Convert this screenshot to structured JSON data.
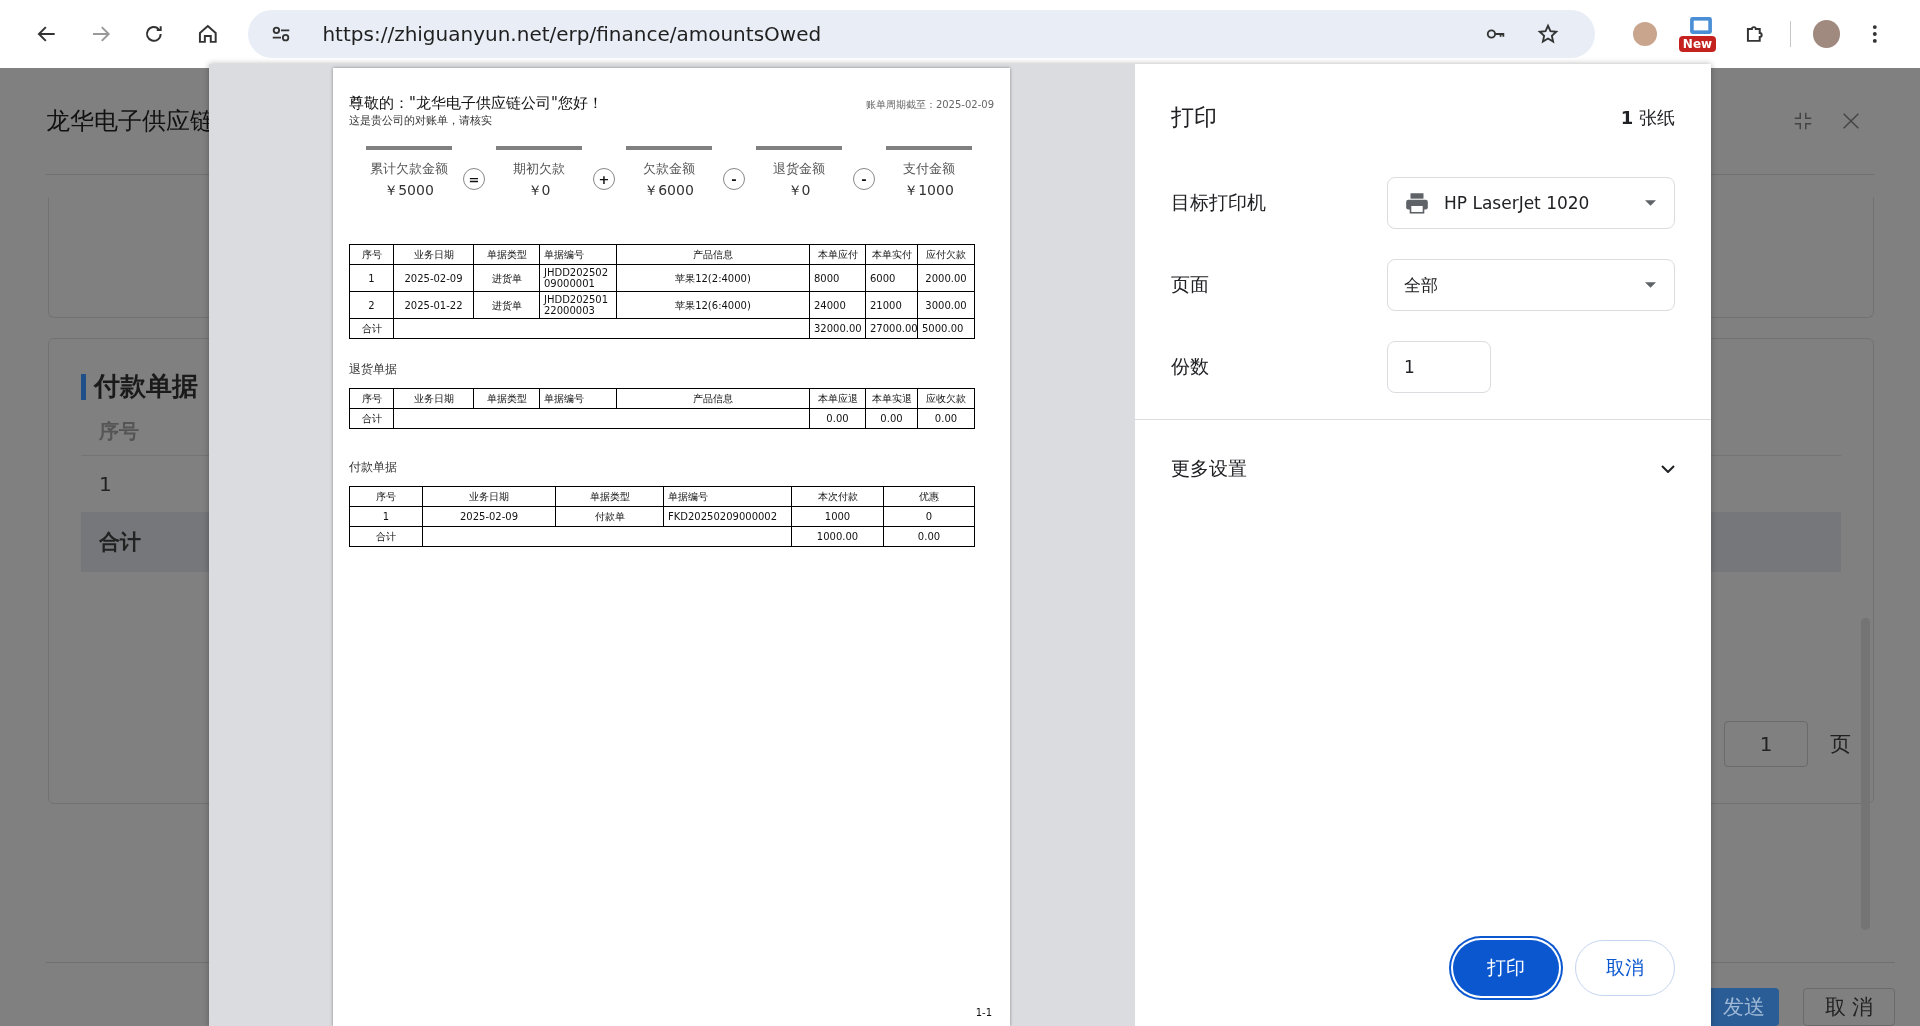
{
  "browser": {
    "url": "https://zhiguanyun.net/erp/finance/amountsOwed",
    "extension_badge": "New"
  },
  "background_page": {
    "title": "龙华电子供应链",
    "section_title": "付款单据",
    "column_header": "序号",
    "row_index": "1",
    "total_label": "合计",
    "page_input": "1",
    "page_unit": "页",
    "send_button": "发送",
    "cancel_button": "取 消"
  },
  "print_preview": {
    "greeting": "尊敬的：\"龙华电子供应链公司\"您好！",
    "subtitle": "这是贵公司的对账单，请核实",
    "period": "账单周期截至：2025-02-09",
    "summary": [
      {
        "label": "累计欠款金额",
        "amount": "￥5000"
      },
      {
        "label": "期初欠款",
        "amount": "￥0"
      },
      {
        "label": "欠款金额",
        "amount": "￥6000"
      },
      {
        "label": "退货金额",
        "amount": "￥0"
      },
      {
        "label": "支付金额",
        "amount": "￥1000"
      }
    ],
    "operators": [
      "=",
      "+",
      "-",
      "-"
    ],
    "tables": [
      {
        "columns": [
          "序号",
          "业务日期",
          "单据类型",
          "单据编号",
          "产品信息",
          "本单应付",
          "本单实付",
          "应付欠款"
        ],
        "rows": [
          [
            "1",
            "2025-02-09",
            "进货单",
            "JHDD20250209000001",
            "苹果12(2:4000)",
            "8000",
            "6000",
            "2000.00"
          ],
          [
            "2",
            "2025-01-22",
            "进货单",
            "JHDD20250122000003",
            "苹果12(6:4000)",
            "24000",
            "21000",
            "3000.00"
          ]
        ],
        "total": {
          "label": "合计",
          "values": [
            "32000.00",
            "27000.00",
            "5000.00"
          ]
        }
      },
      {
        "title": "退货单据",
        "columns": [
          "序号",
          "业务日期",
          "单据类型",
          "单据编号",
          "产品信息",
          "本单应退",
          "本单实退",
          "应收欠款"
        ],
        "total": {
          "label": "合计",
          "values": [
            "0.00",
            "0.00",
            "0.00"
          ]
        }
      },
      {
        "title": "付款单据",
        "columns": [
          "序号",
          "业务日期",
          "单据类型",
          "单据编号",
          "本次付款",
          "优惠"
        ],
        "rows": [
          [
            "1",
            "2025-02-09",
            "付款单",
            "FKD20250209000002",
            "1000",
            "0"
          ]
        ],
        "total": {
          "label": "合计",
          "values": [
            "1000.00",
            "0.00"
          ]
        }
      }
    ],
    "page_number": "1-1"
  },
  "print_dialog": {
    "title": "打印",
    "sheet_count": "**1** 张纸",
    "settings": [
      {
        "kind": "printer",
        "label": "目标打印机",
        "value": "HP LaserJet 1020"
      },
      {
        "kind": "select",
        "label": "页面",
        "value": "全部"
      },
      {
        "kind": "number",
        "label": "份数",
        "value": "1"
      }
    ],
    "more_settings": {
      "label": "更多设置",
      "expanded": false
    },
    "buttons": [
      {
        "label": "打印",
        "primary": true
      },
      {
        "label": "取消",
        "primary": false
      }
    ]
  }
}
